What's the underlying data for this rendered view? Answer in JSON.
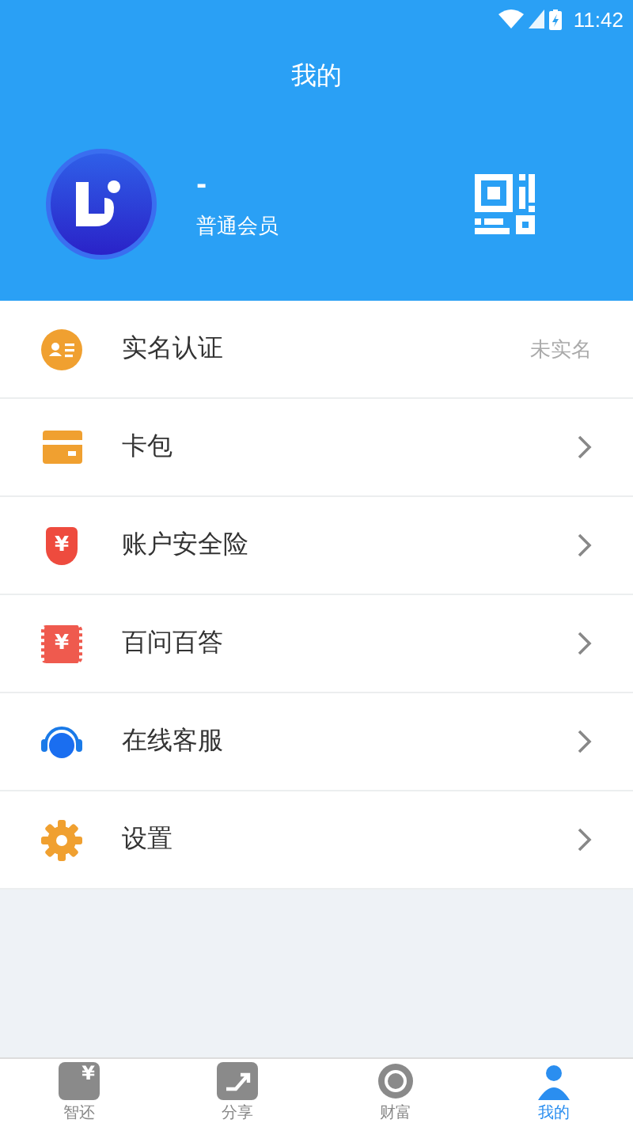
{
  "status_bar": {
    "time": "11:42"
  },
  "header": {
    "title": "我的"
  },
  "profile": {
    "name": "-",
    "level": "普通会员"
  },
  "menu": [
    {
      "label": "实名认证",
      "value": "未实名"
    },
    {
      "label": "卡包"
    },
    {
      "glyph": "¥",
      "label": "账户安全险"
    },
    {
      "glyph": "¥",
      "label": "百问百答"
    },
    {
      "label": "在线客服"
    },
    {
      "label": "设置"
    }
  ],
  "tabs": [
    {
      "glyph": "¥",
      "label": "智还",
      "selected": false
    },
    {
      "label": "分享",
      "selected": false
    },
    {
      "label": "财富",
      "selected": false
    },
    {
      "label": "我的",
      "selected": true
    }
  ]
}
